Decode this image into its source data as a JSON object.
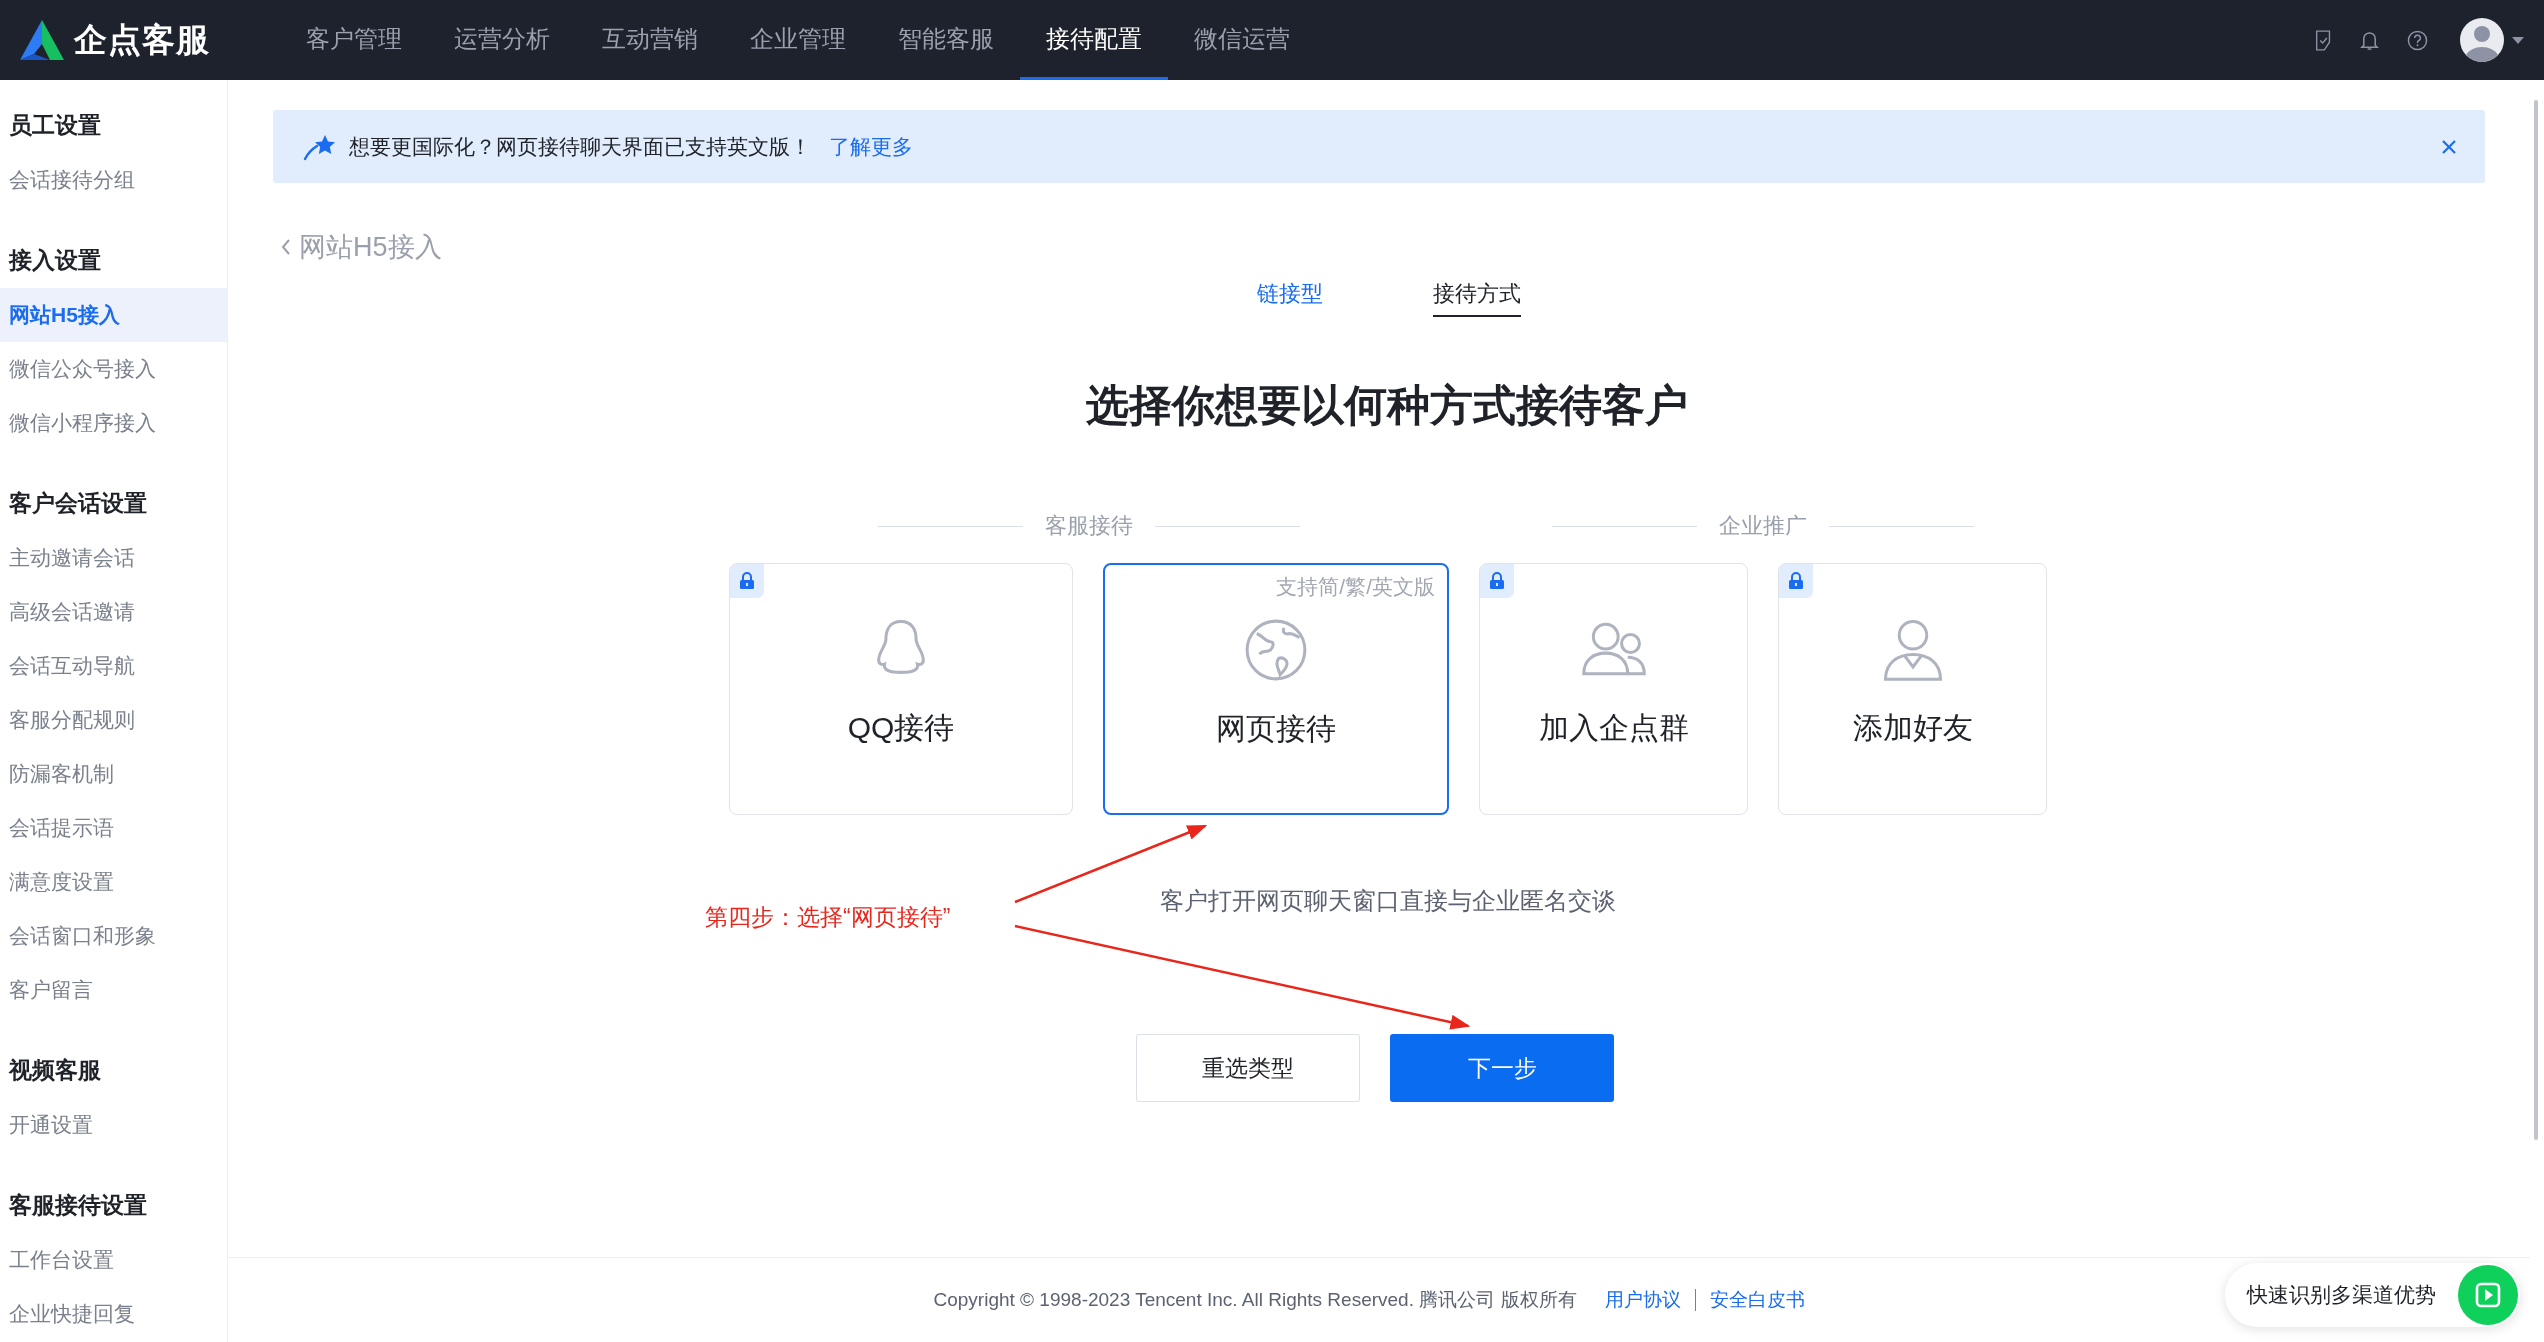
{
  "topbar": {
    "logo": "企点客服",
    "nav": [
      {
        "label": "客户管理",
        "selected": false
      },
      {
        "label": "运营分析",
        "selected": false
      },
      {
        "label": "互动营销",
        "selected": false
      },
      {
        "label": "企业管理",
        "selected": false
      },
      {
        "label": "智能客服",
        "selected": false
      },
      {
        "label": "接待配置",
        "selected": true
      },
      {
        "label": "微信运营",
        "selected": false
      }
    ]
  },
  "sidebar": {
    "groups": [
      {
        "title": "员工设置",
        "items": [
          {
            "label": "会话接待分组",
            "selected": false
          }
        ]
      },
      {
        "title": "接入设置",
        "items": [
          {
            "label": "网站H5接入",
            "selected": true
          },
          {
            "label": "微信公众号接入",
            "selected": false
          },
          {
            "label": "微信小程序接入",
            "selected": false
          }
        ]
      },
      {
        "title": "客户会话设置",
        "items": [
          {
            "label": "主动邀请会话",
            "selected": false
          },
          {
            "label": "高级会话邀请",
            "selected": false
          },
          {
            "label": "会话互动导航",
            "selected": false
          },
          {
            "label": "客服分配规则",
            "selected": false
          },
          {
            "label": "防漏客机制",
            "selected": false
          },
          {
            "label": "会话提示语",
            "selected": false
          },
          {
            "label": "满意度设置",
            "selected": false
          },
          {
            "label": "会话窗口和形象",
            "selected": false
          },
          {
            "label": "客户留言",
            "selected": false
          }
        ]
      },
      {
        "title": "视频客服",
        "items": [
          {
            "label": "开通设置",
            "selected": false
          }
        ]
      },
      {
        "title": "客服接待设置",
        "items": [
          {
            "label": "工作台设置",
            "selected": false
          },
          {
            "label": "企业快捷回复",
            "selected": false
          }
        ]
      }
    ]
  },
  "banner": {
    "text": "想要更国际化？网页接待聊天界面已支持英文版！",
    "link": "了解更多"
  },
  "back_link": "网站H5接入",
  "steps": [
    {
      "label": "链接型",
      "selected": false
    },
    {
      "label": "接待方式",
      "selected": true
    }
  ],
  "heading": "选择你想要以何种方式接待客户",
  "groups": [
    {
      "title": "客服接待",
      "cards": [
        {
          "label": "QQ接待",
          "locked": true,
          "selected": false
        },
        {
          "label": "网页接待",
          "note": "支持简/繁/英文版",
          "locked": false,
          "selected": true
        }
      ]
    },
    {
      "title": "企业推广",
      "cards": [
        {
          "label": "加入企点群",
          "locked": true,
          "selected": false
        },
        {
          "label": "添加好友",
          "locked": true,
          "selected": false
        }
      ]
    }
  ],
  "description": "客户打开网页聊天窗口直接与企业匿名交谈",
  "annotation": "第四步：选择“网页接待”",
  "buttons": [
    {
      "label": "重选类型",
      "kind": "secondary"
    },
    {
      "label": "下一步",
      "kind": "primary"
    }
  ],
  "footer": {
    "copyright": "Copyright © 1998-2023 Tencent Inc. All Rights Reserved. 腾讯公司 版权所有",
    "links": [
      "用户协议",
      "安全白皮书"
    ]
  },
  "float_widget": {
    "text": "快速识别多渠道优势"
  }
}
